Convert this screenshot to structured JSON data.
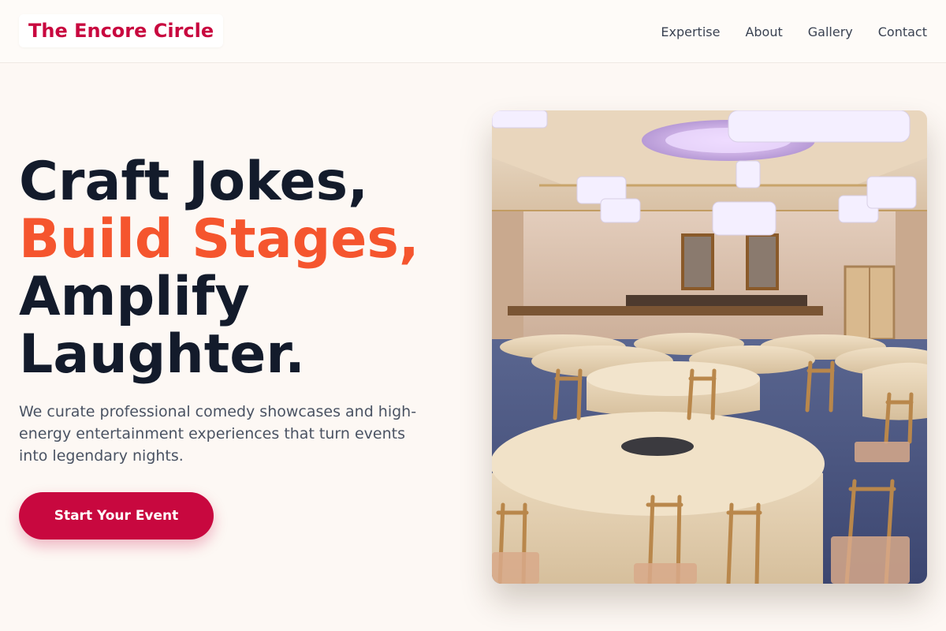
{
  "header": {
    "logo_text": "The Encore Circle",
    "nav": [
      {
        "label": "Expertise"
      },
      {
        "label": "About"
      },
      {
        "label": "Gallery"
      },
      {
        "label": "Contact"
      }
    ]
  },
  "hero": {
    "title_line1": "Craft Jokes,",
    "title_line2": "Build Stages,",
    "title_line3": "Amplify",
    "title_line4": "Laughter.",
    "subtitle": "We curate professional comedy showcases and high-energy entertainment experiences that turn events into legendary nights.",
    "cta_label": "Start Your Event",
    "image_subject": "ballroom banquet hall with chandeliers and round tables"
  },
  "colors": {
    "brand": "#c8083f",
    "accent": "#f5552e",
    "heading": "#131b2b",
    "body_text": "#4a5363",
    "background": "#fdf8f4"
  }
}
